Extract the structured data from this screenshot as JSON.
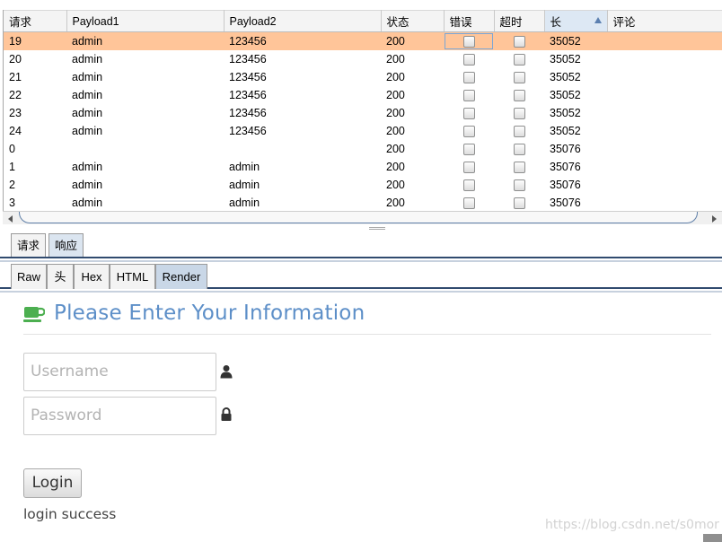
{
  "table": {
    "columns": [
      "请求",
      "Payload1",
      "Payload2",
      "状态",
      "错误",
      "超时",
      "长",
      "评论"
    ],
    "rows": [
      {
        "request": "19",
        "payload1": "admin",
        "payload2": "123456",
        "status": "200",
        "error": false,
        "timeout": false,
        "length": "35052",
        "comment": ""
      },
      {
        "request": "20",
        "payload1": "admin",
        "payload2": "123456",
        "status": "200",
        "error": false,
        "timeout": false,
        "length": "35052",
        "comment": ""
      },
      {
        "request": "21",
        "payload1": "admin",
        "payload2": "123456",
        "status": "200",
        "error": false,
        "timeout": false,
        "length": "35052",
        "comment": ""
      },
      {
        "request": "22",
        "payload1": "admin",
        "payload2": "123456",
        "status": "200",
        "error": false,
        "timeout": false,
        "length": "35052",
        "comment": ""
      },
      {
        "request": "23",
        "payload1": "admin",
        "payload2": "123456",
        "status": "200",
        "error": false,
        "timeout": false,
        "length": "35052",
        "comment": ""
      },
      {
        "request": "24",
        "payload1": "admin",
        "payload2": "123456",
        "status": "200",
        "error": false,
        "timeout": false,
        "length": "35052",
        "comment": ""
      },
      {
        "request": "0",
        "payload1": "",
        "payload2": "",
        "status": "200",
        "error": false,
        "timeout": false,
        "length": "35076",
        "comment": ""
      },
      {
        "request": "1",
        "payload1": "admin",
        "payload2": "admin",
        "status": "200",
        "error": false,
        "timeout": false,
        "length": "35076",
        "comment": ""
      },
      {
        "request": "2",
        "payload1": "admin",
        "payload2": "admin",
        "status": "200",
        "error": false,
        "timeout": false,
        "length": "35076",
        "comment": ""
      },
      {
        "request": "3",
        "payload1": "admin",
        "payload2": "admin",
        "status": "200",
        "error": false,
        "timeout": false,
        "length": "35076",
        "comment": ""
      }
    ],
    "selected_row": 0,
    "sort_column": "长",
    "sort_direction": "ascending"
  },
  "message_tabs": {
    "request": "请求",
    "response": "响应",
    "active": "响应"
  },
  "view_tabs": {
    "raw": "Raw",
    "headers": "头",
    "hex": "Hex",
    "html": "HTML",
    "render": "Render",
    "active": "Render"
  },
  "render": {
    "heading": "Please Enter Your Information",
    "username_placeholder": "Username",
    "password_placeholder": "Password",
    "login_label": "Login",
    "status_message": "login success",
    "watermark": "https://blog.csdn.net/s0mor",
    "heading_color": "#5d8fc8",
    "cup_icon_color": "#4caf50",
    "icons": {
      "heading": "coffee-cup-icon",
      "username": "user-icon",
      "password": "lock-icon"
    }
  },
  "colors": {
    "selected_row": "#ffc599",
    "tab_underline": "#314b6f"
  }
}
